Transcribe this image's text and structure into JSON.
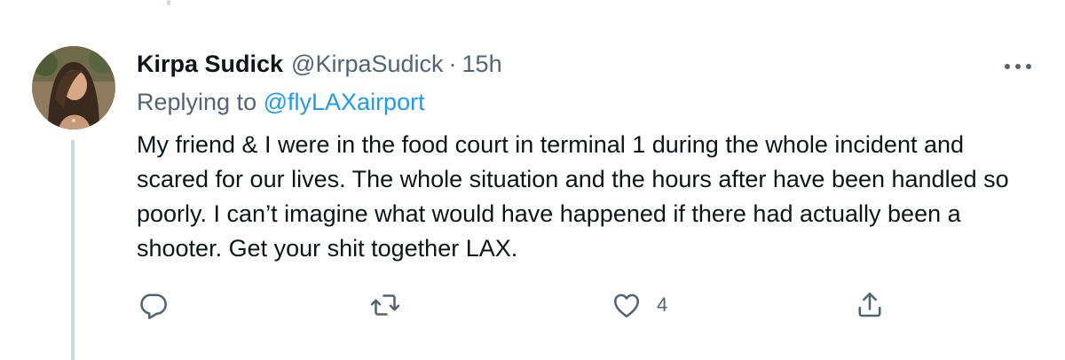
{
  "tweet": {
    "author_name": "Kirpa Sudick",
    "handle": "@KirpaSudick",
    "separator": "·",
    "time": "15h",
    "replying_prefix": "Replying to",
    "replying_to": "@flyLAXairport",
    "text": "My friend & I were in the food court in terminal 1 during the whole incident and scared for our lives. The whole situation and the hours after have been handled so poorly. I can’t imagine what would have happened if there had actually been a shooter. Get your shit together LAX.",
    "like_count": "4"
  },
  "icons": {
    "more": "more-horizontal-icon",
    "reply": "reply-icon",
    "retweet": "retweet-icon",
    "like": "heart-icon",
    "share": "share-icon"
  },
  "colors": {
    "text": "#0f1419",
    "secondary": "#536471",
    "link": "#1d9bf0",
    "thread_line": "#cfd9de"
  }
}
